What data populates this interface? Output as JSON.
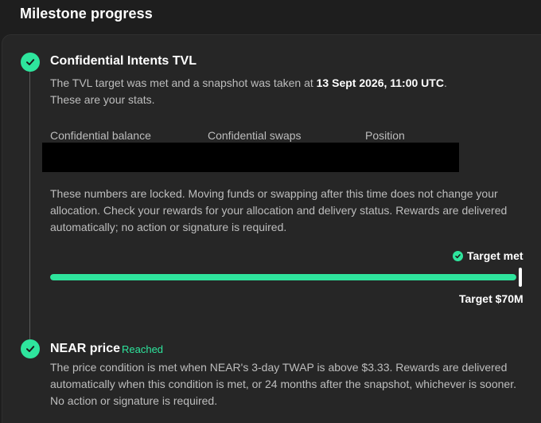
{
  "section_title": "Milestone progress",
  "colors": {
    "accent": "#2ee59d",
    "background": "#1e1e1e",
    "card": "#262626"
  },
  "milestones": [
    {
      "icon": "check-circle-icon",
      "title": "Confidential Intents TVL",
      "snapshot_prefix": "The TVL target was met and a snapshot was taken at ",
      "snapshot_time": "13 Sept 2026, 11:00 UTC",
      "snapshot_suffix": ".",
      "stats_intro": "These are your stats.",
      "stats": {
        "labels": [
          "Confidential balance",
          "Confidential swaps",
          "Position"
        ]
      },
      "locked_note": "These numbers are locked. Moving funds or swapping after this time does not change your allocation. Check your rewards for your allocation and delivery status. Rewards are delivered automatically; no action or signature is required.",
      "status_label": "Target met",
      "progress": 1.0,
      "target_label": "Target $70M"
    },
    {
      "icon": "check-circle-icon",
      "title": "NEAR price",
      "badge": "Reached",
      "description": "The price condition is met when NEAR's 3-day TWAP is above $3.33. Rewards are delivered automatically when this condition is met, or 24 months after the snapshot, whichever is sooner. No action or signature is required."
    }
  ]
}
